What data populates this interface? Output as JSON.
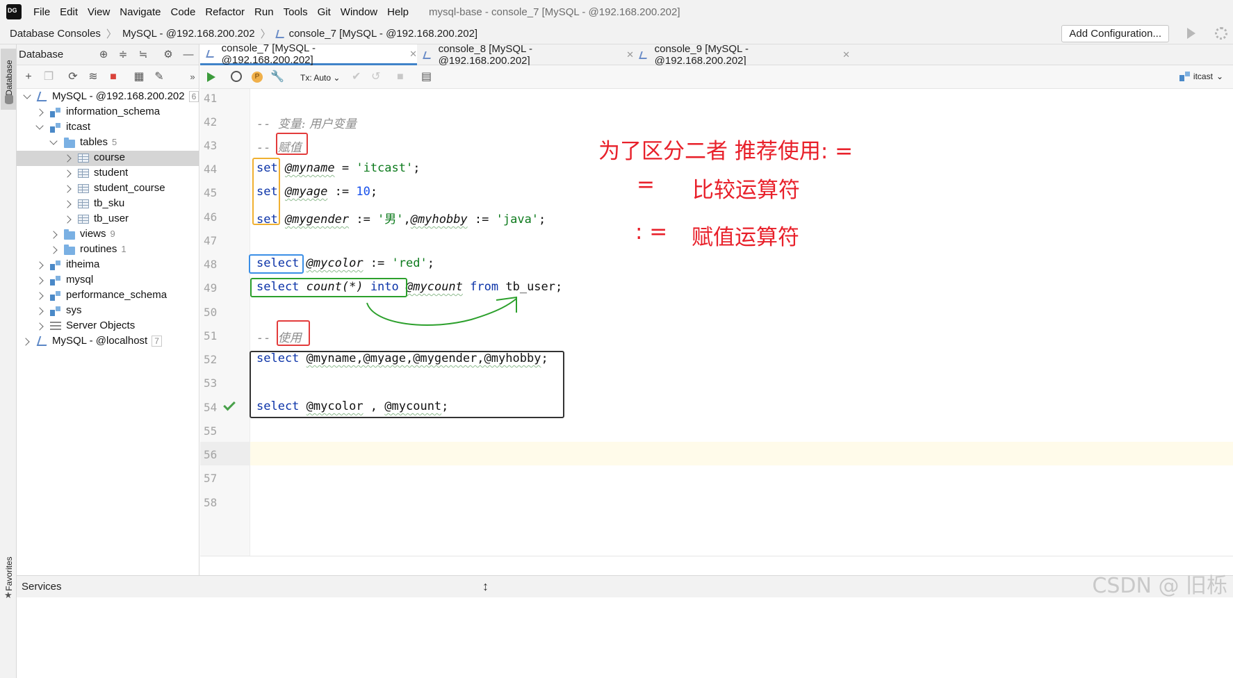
{
  "menu": {
    "items": [
      "File",
      "Edit",
      "View",
      "Navigate",
      "Code",
      "Refactor",
      "Run",
      "Tools",
      "Git",
      "Window",
      "Help"
    ],
    "window_title": "mysql-base - console_7 [MySQL - @192.168.200.202]"
  },
  "navbar": {
    "crumb1": "Database Consoles",
    "crumb2": "MySQL - @192.168.200.202",
    "crumb3": "console_7 [MySQL - @192.168.200.202]",
    "add_configuration": "Add Configuration..."
  },
  "left_strip": {
    "database": "Database",
    "favorites": "Favorites"
  },
  "db_panel": {
    "title": "Database",
    "tree": [
      {
        "label": "MySQL - @192.168.200.202",
        "count": "6"
      },
      {
        "label": "information_schema"
      },
      {
        "label": "itcast"
      },
      {
        "label": "tables",
        "count": "5"
      },
      {
        "label": "course"
      },
      {
        "label": "student"
      },
      {
        "label": "student_course"
      },
      {
        "label": "tb_sku"
      },
      {
        "label": "tb_user"
      },
      {
        "label": "views",
        "count": "9"
      },
      {
        "label": "routines",
        "count": "1"
      },
      {
        "label": "itheima"
      },
      {
        "label": "mysql"
      },
      {
        "label": "performance_schema"
      },
      {
        "label": "sys"
      },
      {
        "label": "Server Objects"
      },
      {
        "label": "MySQL - @localhost",
        "count": "7"
      }
    ]
  },
  "tabs": [
    {
      "label": "console_7 [MySQL - @192.168.200.202]"
    },
    {
      "label": "console_8 [MySQL - @192.168.200.202]"
    },
    {
      "label": "console_9 [MySQL - @192.168.200.202]"
    }
  ],
  "editor_toolbar": {
    "tx_mode": "Tx: Auto",
    "schema": "itcast"
  },
  "editor": {
    "line_numbers": [
      "41",
      "42",
      "43",
      "44",
      "45",
      "46",
      "47",
      "48",
      "49",
      "50",
      "51",
      "52",
      "53",
      "54",
      "55",
      "56",
      "57",
      "58"
    ],
    "line42": {
      "prefix": "-- ",
      "text": "变量: 用户变量"
    },
    "line43": {
      "prefix": "-- ",
      "text": "赋值"
    },
    "line44": {
      "kw": "set",
      "var": "@myname",
      "op": " = ",
      "str": "'itcast'",
      "end": ";"
    },
    "line45": {
      "kw": "set",
      "var": "@myage",
      "op": " := ",
      "num": "10",
      "end": ";"
    },
    "line46": {
      "kw": "set",
      "var": "@mygender",
      "op": " := ",
      "str": "'男'",
      "comma": ",",
      "var2": "@myhobby",
      "op2": " := ",
      "str2": "'java'",
      "end": ";"
    },
    "line48": {
      "kw": "select",
      "var": "@mycolor",
      "op": " := ",
      "str": "'red'",
      "end": ";"
    },
    "line49": {
      "kw": "select",
      "fn": "count(*)",
      "kw2": "into",
      "var": "@mycount",
      "kw3": "from",
      "table": "tb_user",
      "end": ";"
    },
    "line51": {
      "prefix": "-- ",
      "text": "使用"
    },
    "line52": {
      "kw": "select",
      "vars": "@myname,@myage,@mygender,@myhobby",
      "end": ";"
    },
    "line54": {
      "kw": "select",
      "var": "@mycolor",
      "sep": " , ",
      "var2": "@mycount",
      "end": ";"
    }
  },
  "annotations": {
    "title": "为了区分二者 推荐使用: =",
    "row1_symbol": "=",
    "row1_text": "比较运算符",
    "row2_symbol": ": =",
    "row2_text": "赋值运算符"
  },
  "bottom": {
    "services": "Services",
    "watermark": "CSDN @ 旧栎"
  },
  "colors": {
    "keyword": "#0b33a8",
    "string": "#0c7a1c",
    "number": "#1750eb",
    "annotation_red": "#e8202a",
    "box_yellow": "#f0b030",
    "box_blue": "#3a8ee6",
    "box_green": "#2ca02c",
    "box_black": "#333333"
  }
}
